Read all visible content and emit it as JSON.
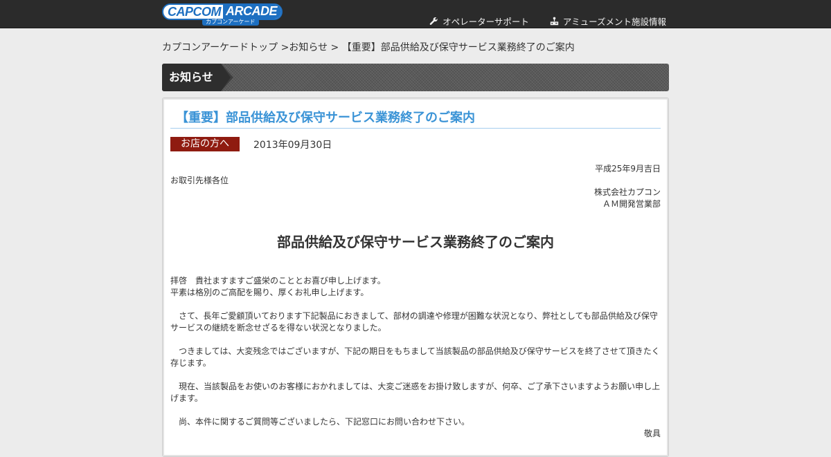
{
  "header": {
    "logo_capcom": "CAPCOM",
    "logo_arcade": "ARCADE",
    "logo_sub": "カプコンアーケード",
    "nav": [
      {
        "label": "オペレーターサポート",
        "icon": "wrench-icon"
      },
      {
        "label": "アミューズメント施設情報",
        "icon": "arcade-machine-icon"
      }
    ]
  },
  "breadcrumb": {
    "home": "カプコンアーケードトップ",
    "sep1": " >",
    "news": "お知らせ",
    "sep2": " > ",
    "current": "【重要】部品供給及び保守サービス業務終了のご案内"
  },
  "section": {
    "title": "お知らせ"
  },
  "article": {
    "title": "【重要】部品供給及び保守サービス業務終了のご案内",
    "tag": "お店の方へ",
    "date": "2013年09月30日",
    "issued_date": "平成25年9月吉日",
    "recipient": "お取引先様各位",
    "company": "株式会社カプコン",
    "department": "ＡＭ開発営業部",
    "doc_title": "部品供給及び保守サービス業務終了のご案内",
    "greeting_1": "拝啓　貴社ますますご盛栄のこととお喜び申し上げます。",
    "greeting_2": "平素は格別のご高配を賜り、厚くお礼申し上げます。",
    "para_1": "　さて、長年ご愛顧頂いております下記製品におきまして、部材の調達や修理が困難な状況となり、弊社としても部品供給及び保守サービスの継続を断念せざるを得ない状況となりました。",
    "para_2": "　つきましては、大変残念ではございますが、下記の期日をもちまして当該製品の部品供給及び保守サービスを終了させて頂きたく存じます。",
    "para_3": "　現在、当該製品をお使いのお客様におかれましては、大変ご迷惑をお掛け致しますが、何卒、ご了承下さいますようお願い申し上げます。",
    "para_4": "　尚、本件に関するご質問等ございましたら、下記窓口にお問い合わせ下さい。",
    "closing": "敬具"
  },
  "colors": {
    "header_bg": "#2b2b2b",
    "title_blue": "#3a93d6",
    "tag_red": "#8f1b10",
    "logo_blue": "#1d6fc1"
  }
}
